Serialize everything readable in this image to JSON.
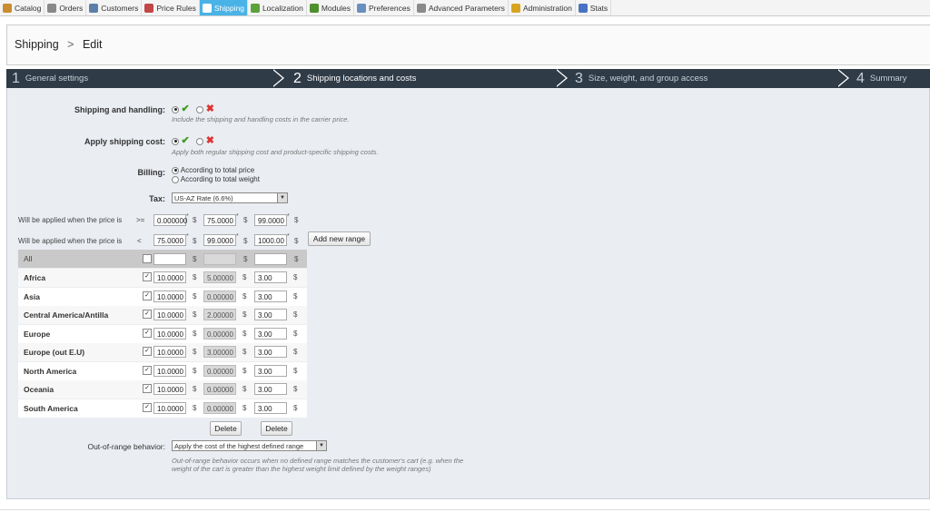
{
  "tabs": [
    {
      "label": "Catalog",
      "icon": "catalog-icon",
      "color": "#c98c2e"
    },
    {
      "label": "Orders",
      "icon": "orders-icon",
      "color": "#888888"
    },
    {
      "label": "Customers",
      "icon": "customers-icon",
      "color": "#5b7fa8"
    },
    {
      "label": "Price Rules",
      "icon": "price-rules-icon",
      "color": "#c24646"
    },
    {
      "label": "Shipping",
      "icon": "shipping-icon",
      "color": "#ffffff",
      "active": true
    },
    {
      "label": "Localization",
      "icon": "localization-icon",
      "color": "#5aa23a"
    },
    {
      "label": "Modules",
      "icon": "modules-icon",
      "color": "#4e8f2e"
    },
    {
      "label": "Preferences",
      "icon": "preferences-icon",
      "color": "#6a8fbf"
    },
    {
      "label": "Advanced Parameters",
      "icon": "advanced-parameters-icon",
      "color": "#8a8a8a"
    },
    {
      "label": "Administration",
      "icon": "administration-icon",
      "color": "#d6a520"
    },
    {
      "label": "Stats",
      "icon": "stats-icon",
      "color": "#4972c4"
    }
  ],
  "breadcrumb": {
    "section": "Shipping",
    "separator": ">",
    "page": "Edit"
  },
  "steps": [
    {
      "num": "1",
      "label": "General settings"
    },
    {
      "num": "2",
      "label": "Shipping locations and costs",
      "active": true
    },
    {
      "num": "3",
      "label": "Size, weight, and group access"
    },
    {
      "num": "4",
      "label": "Summary"
    }
  ],
  "form": {
    "shipping_handling": {
      "label": "Shipping and handling:",
      "help": "Include the shipping and handling costs in the carrier price."
    },
    "apply_cost": {
      "label": "Apply shipping cost:",
      "help": "Apply both regular shipping cost and product-specific shipping costs."
    },
    "billing": {
      "label": "Billing:",
      "options": [
        "According to total price",
        "According to total weight"
      ]
    },
    "tax": {
      "label": "Tax:",
      "value": "US-AZ Rate (6.6%)"
    },
    "ranges": {
      "row_label": "Will be applied when the price is",
      "op_from": ">=",
      "op_to": "<",
      "from": [
        "0.000000",
        "75.0000",
        "99.0000"
      ],
      "to": [
        "75.0000",
        "99.0000",
        "1000.00"
      ],
      "asterisk": "*",
      "currency": "$",
      "add_button": "Add new range"
    },
    "all_row_label": "All",
    "zones": [
      {
        "name": "Africa",
        "values": [
          "10.0000",
          "5.00000",
          "3.00"
        ]
      },
      {
        "name": "Asia",
        "values": [
          "10.0000",
          "0.00000",
          "3.00"
        ]
      },
      {
        "name": "Central America/Antilla",
        "values": [
          "10.0000",
          "2.00000",
          "3.00"
        ]
      },
      {
        "name": "Europe",
        "values": [
          "10.0000",
          "0.00000",
          "3.00"
        ]
      },
      {
        "name": "Europe (out E.U)",
        "values": [
          "10.0000",
          "3.00000",
          "3.00"
        ]
      },
      {
        "name": "North America",
        "values": [
          "10.0000",
          "0.00000",
          "3.00"
        ]
      },
      {
        "name": "Oceania",
        "values": [
          "10.0000",
          "0.00000",
          "3.00"
        ]
      },
      {
        "name": "South America",
        "values": [
          "10.0000",
          "0.00000",
          "3.00"
        ]
      }
    ],
    "delete_label": "Delete",
    "out_of_range": {
      "label": "Out-of-range behavior:",
      "value": "Apply the cost of the highest defined range",
      "help": "Out-of-range behavior occurs when no defined range matches the customer's cart (e.g. when the weight of the cart is greater than the highest weight limit defined by the weight ranges)"
    }
  }
}
